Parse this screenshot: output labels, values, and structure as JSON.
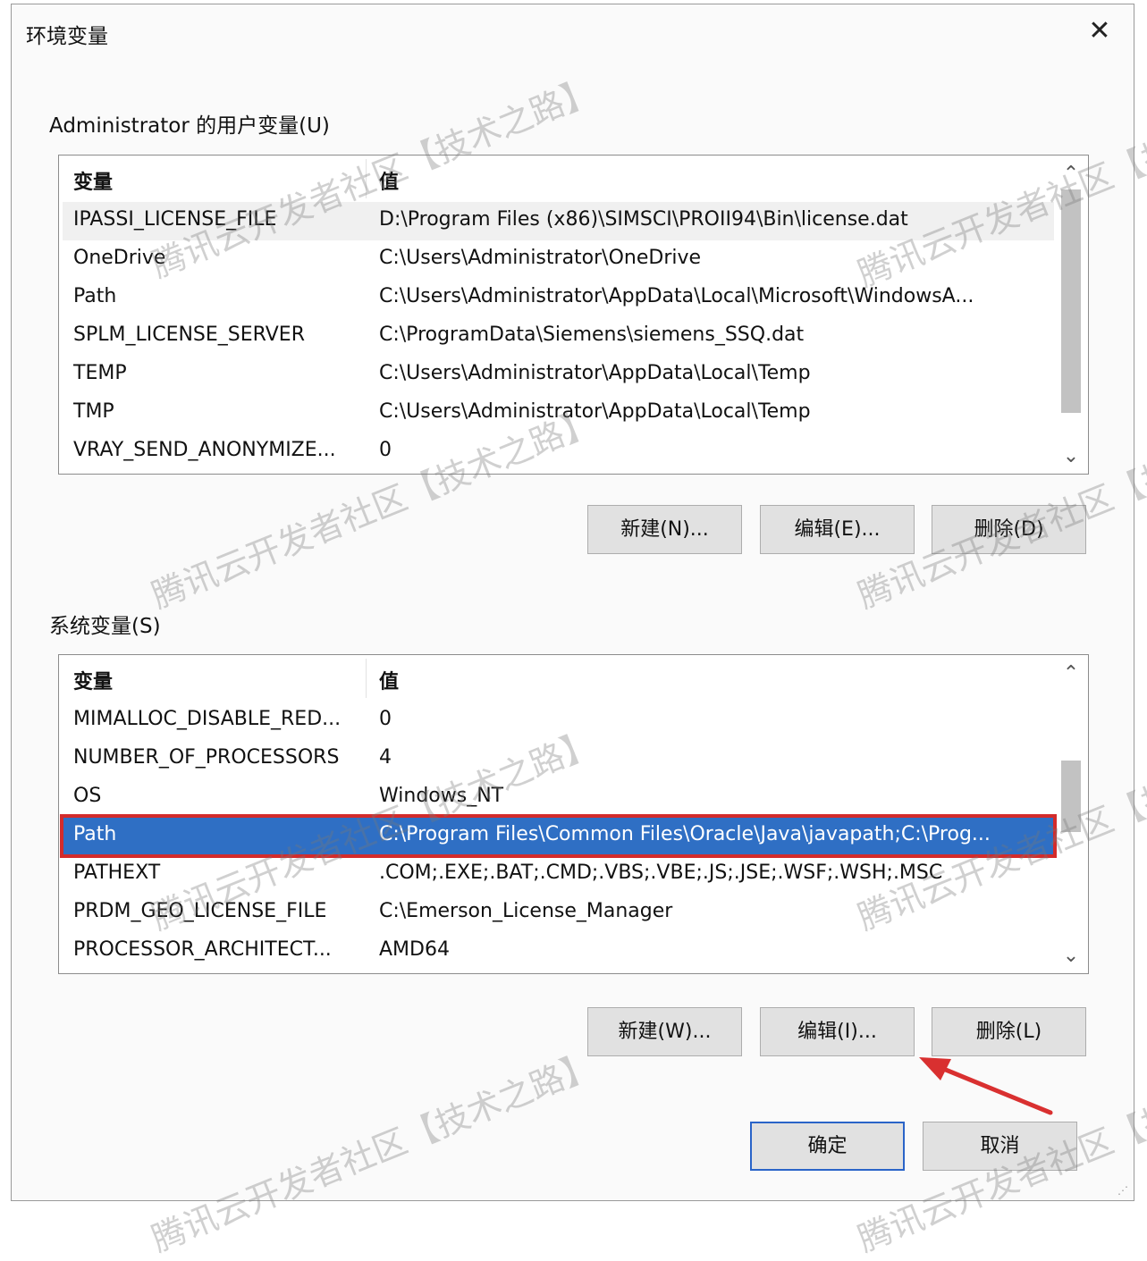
{
  "window": {
    "title": "环境变量",
    "close_glyph": "✕"
  },
  "user_section": {
    "label": "Administrator 的用户变量(U)",
    "headers": {
      "name": "变量",
      "value": "值"
    },
    "rows": [
      {
        "name": "IPASSI_LICENSE_FILE",
        "value": "D:\\Program Files (x86)\\SIMSCI\\PROII94\\Bin\\license.dat"
      },
      {
        "name": "OneDrive",
        "value": "C:\\Users\\Administrator\\OneDrive"
      },
      {
        "name": "Path",
        "value": "C:\\Users\\Administrator\\AppData\\Local\\Microsoft\\WindowsA..."
      },
      {
        "name": "SPLM_LICENSE_SERVER",
        "value": "C:\\ProgramData\\Siemens\\siemens_SSQ.dat"
      },
      {
        "name": "TEMP",
        "value": "C:\\Users\\Administrator\\AppData\\Local\\Temp"
      },
      {
        "name": "TMP",
        "value": "C:\\Users\\Administrator\\AppData\\Local\\Temp"
      },
      {
        "name": "VRAY_SEND_ANONYMIZE...",
        "value": "0"
      }
    ],
    "buttons": {
      "new": "新建(N)...",
      "edit": "编辑(E)...",
      "delete": "删除(D)"
    }
  },
  "system_section": {
    "label": "系统变量(S)",
    "headers": {
      "name": "变量",
      "value": "值"
    },
    "rows": [
      {
        "name": "MIMALLOC_DISABLE_RED...",
        "value": "0"
      },
      {
        "name": "NUMBER_OF_PROCESSORS",
        "value": "4"
      },
      {
        "name": "OS",
        "value": "Windows_NT"
      },
      {
        "name": "Path",
        "value": "C:\\Program Files\\Common Files\\Oracle\\Java\\javapath;C:\\Prog..."
      },
      {
        "name": "PATHEXT",
        "value": ".COM;.EXE;.BAT;.CMD;.VBS;.VBE;.JS;.JSE;.WSF;.WSH;.MSC"
      },
      {
        "name": "PRDM_GEO_LICENSE_FILE",
        "value": "C:\\Emerson_License_Manager"
      },
      {
        "name": "PROCESSOR_ARCHITECT...",
        "value": "AMD64"
      }
    ],
    "selected_index": 3,
    "buttons": {
      "new": "新建(W)...",
      "edit": "编辑(I)...",
      "delete": "删除(L)"
    }
  },
  "footer": {
    "ok": "确定",
    "cancel": "取消"
  },
  "scroll_arrows": {
    "up": "⌃",
    "down": "⌄"
  },
  "watermark": "腾讯云开发者社区【技术之路】",
  "colors": {
    "selection": "#2f6fc4",
    "highlight_box": "#d32b2b",
    "annotation_arrow": "#d93030"
  }
}
